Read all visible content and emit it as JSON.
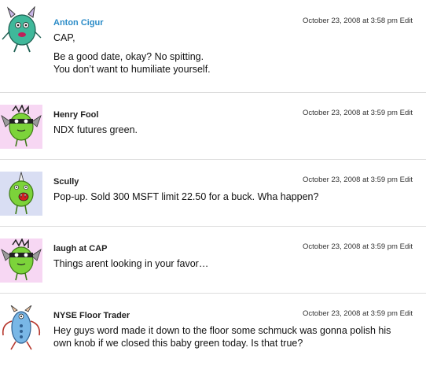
{
  "comments": [
    {
      "author": "Anton Cigur",
      "author_is_link": true,
      "date": "October 23, 2008 at 3:58 pm",
      "edit_label": "Edit",
      "paragraphs": [
        "CAP,",
        "Be a good date, okay? No spitting.",
        "You don’t want to humiliate yourself."
      ],
      "avatar": "teal-monster-avatar"
    },
    {
      "author": "Henry Fool",
      "author_is_link": false,
      "date": "October 23, 2008 at 3:59 pm",
      "edit_label": "Edit",
      "paragraphs": [
        "NDX futures green."
      ],
      "avatar": "green-bat-monster-avatar"
    },
    {
      "author": "Scully",
      "author_is_link": false,
      "date": "October 23, 2008 at 3:59 pm",
      "edit_label": "Edit",
      "paragraphs": [
        "Pop-up. Sold 300 MSFT limit 22.50 for a buck. Wha happen?"
      ],
      "avatar": "green-horned-monster-avatar"
    },
    {
      "author": "laugh at CAP",
      "author_is_link": false,
      "date": "October 23, 2008 at 3:59 pm",
      "edit_label": "Edit",
      "paragraphs": [
        "Things arent looking in your favor…"
      ],
      "avatar": "green-bat-monster-avatar"
    },
    {
      "author": "NYSE Floor Trader",
      "author_is_link": false,
      "date": "October 23, 2008 at 3:59 pm",
      "edit_label": "Edit",
      "paragraphs": [
        "Hey guys word made it down to the floor some schmuck was gonna polish his own knob if we closed this baby green today. Is that true?"
      ],
      "avatar": "blue-bug-monster-avatar"
    }
  ],
  "colors": {
    "link": "#2a8bc7",
    "divider": "#dcdcdc",
    "avatar_bg_pink": "#f7d7f3",
    "avatar_bg_blue": "#d9def3",
    "monster_green": "#7cd33a",
    "monster_teal": "#3fb89a"
  }
}
